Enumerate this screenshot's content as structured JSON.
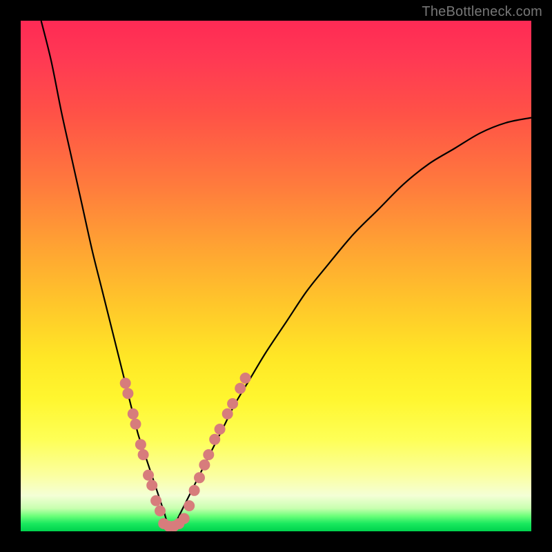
{
  "watermark": "TheBottleneck.com",
  "colors": {
    "frame": "#000000",
    "curve": "#000000",
    "marker_fill": "#d77c7c",
    "marker_stroke": "#c46a6a"
  },
  "chart_data": {
    "type": "line",
    "title": "",
    "xlabel": "",
    "ylabel": "",
    "xlim": [
      0,
      100
    ],
    "ylim": [
      0,
      100
    ],
    "grid": false,
    "legend": false,
    "note": "V-shaped bottleneck curve with minimum near x≈29; values estimated from pixel positions (no axes/ticks shown).",
    "series": [
      {
        "name": "bottleneck-curve",
        "x": [
          4,
          6,
          8,
          10,
          12,
          14,
          16,
          18,
          20,
          22,
          23,
          24,
          25,
          26,
          27,
          28,
          29,
          30,
          31,
          32,
          33,
          34,
          36,
          38,
          40,
          42,
          45,
          48,
          52,
          56,
          60,
          65,
          70,
          75,
          80,
          85,
          90,
          95,
          100
        ],
        "y": [
          100,
          92,
          82,
          73,
          64,
          55,
          47,
          39,
          31,
          23,
          19,
          16,
          13,
          10,
          7,
          4,
          1,
          1,
          3,
          5,
          7,
          9,
          13,
          17,
          21,
          25,
          30,
          35,
          41,
          47,
          52,
          58,
          63,
          68,
          72,
          75,
          78,
          80,
          81
        ]
      }
    ],
    "markers": [
      {
        "name": "left-cluster",
        "points": [
          {
            "x": 20.5,
            "y": 29
          },
          {
            "x": 21,
            "y": 27
          },
          {
            "x": 22,
            "y": 23
          },
          {
            "x": 22.5,
            "y": 21
          },
          {
            "x": 23.5,
            "y": 17
          },
          {
            "x": 24,
            "y": 15
          },
          {
            "x": 25,
            "y": 11
          },
          {
            "x": 25.7,
            "y": 9
          },
          {
            "x": 26.5,
            "y": 6
          },
          {
            "x": 27.3,
            "y": 4
          }
        ]
      },
      {
        "name": "bottom-cluster",
        "points": [
          {
            "x": 28,
            "y": 1.5
          },
          {
            "x": 29,
            "y": 1
          },
          {
            "x": 30,
            "y": 1
          },
          {
            "x": 31,
            "y": 1.5
          },
          {
            "x": 32,
            "y": 2.5
          }
        ]
      },
      {
        "name": "right-cluster",
        "points": [
          {
            "x": 33,
            "y": 5
          },
          {
            "x": 34,
            "y": 8
          },
          {
            "x": 35,
            "y": 10.5
          },
          {
            "x": 36,
            "y": 13
          },
          {
            "x": 36.8,
            "y": 15
          },
          {
            "x": 38,
            "y": 18
          },
          {
            "x": 39,
            "y": 20
          },
          {
            "x": 40.5,
            "y": 23
          },
          {
            "x": 41.5,
            "y": 25
          },
          {
            "x": 43,
            "y": 28
          },
          {
            "x": 44,
            "y": 30
          }
        ]
      }
    ]
  }
}
